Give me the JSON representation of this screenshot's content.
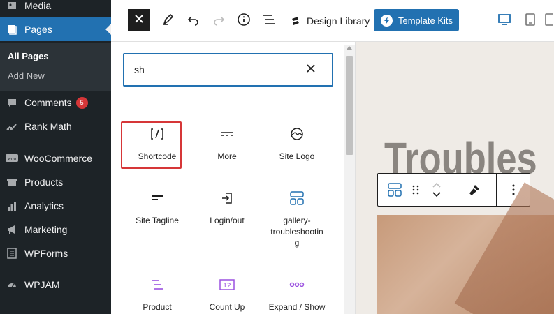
{
  "sidebar": {
    "items": [
      {
        "label": "Media",
        "icon": "media-icon"
      },
      {
        "label": "Pages",
        "icon": "pages-icon"
      },
      {
        "label": "Comments",
        "icon": "comments-icon",
        "badge": "5"
      },
      {
        "label": "Rank Math",
        "icon": "rank-math-icon"
      },
      {
        "label": "WooCommerce",
        "icon": "woocommerce-icon"
      },
      {
        "label": "Products",
        "icon": "products-icon"
      },
      {
        "label": "Analytics",
        "icon": "analytics-icon"
      },
      {
        "label": "Marketing",
        "icon": "marketing-icon"
      },
      {
        "label": "WPForms",
        "icon": "wpforms-icon"
      },
      {
        "label": "WPJAM",
        "icon": "wpjam-icon"
      }
    ],
    "submenu": [
      "All Pages",
      "Add New"
    ]
  },
  "toolbar": {
    "design_library": "Design Library",
    "template_kits": "Template Kits",
    "accent": "#2271b1"
  },
  "inserter": {
    "search_value": "sh",
    "blocks": [
      {
        "label": "Shortcode",
        "icon": "shortcode-icon"
      },
      {
        "label": "More",
        "icon": "more-icon"
      },
      {
        "label": "Site Logo",
        "icon": "site-logo-icon"
      },
      {
        "label": "Site Tagline",
        "icon": "site-tagline-icon"
      },
      {
        "label": "Login/out",
        "icon": "login-out-icon"
      },
      {
        "label": "gallery-troubleshooting",
        "icon": "gallery-icon"
      },
      {
        "label": "Product",
        "icon": "product-icon"
      },
      {
        "label": "Count Up",
        "icon": "count-up-icon"
      },
      {
        "label": "Expand / Show",
        "icon": "expand-icon"
      }
    ],
    "gallery_label_lines": [
      "gallery-",
      "troubleshootin",
      "g"
    ]
  },
  "canvas": {
    "heading": "Troubles"
  }
}
